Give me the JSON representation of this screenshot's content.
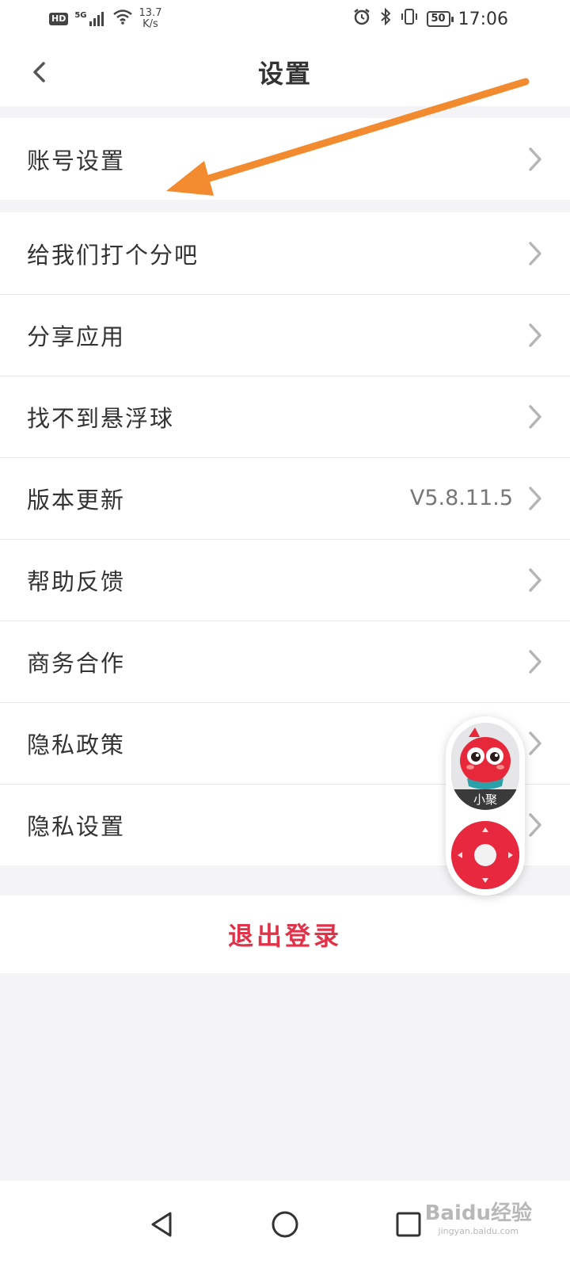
{
  "status_bar": {
    "hd": "HD",
    "net_type": "5G",
    "speed_value": "13.7",
    "speed_unit": "K/s",
    "battery": "50",
    "time": "17:06"
  },
  "header": {
    "title": "设置"
  },
  "account_section": {
    "items": [
      {
        "label": "账号设置"
      }
    ]
  },
  "settings_list": {
    "items": [
      {
        "label": "给我们打个分吧"
      },
      {
        "label": "分享应用"
      },
      {
        "label": "找不到悬浮球"
      },
      {
        "label": "版本更新",
        "value": "V5.8.11.5"
      },
      {
        "label": "帮助反馈"
      },
      {
        "label": "商务合作"
      },
      {
        "label": "隐私政策"
      },
      {
        "label": "隐私设置"
      }
    ]
  },
  "logout": {
    "label": "退出登录",
    "color": "#e0334a"
  },
  "float_ball": {
    "avatar_name": "小聚",
    "accent": "#e8283e"
  },
  "annotation": {
    "arrow_color": "#f28a30"
  },
  "watermark": {
    "main": "Baidu经验",
    "sub": "jingyan.baidu.com"
  },
  "icons": {
    "back": "back-chevron-icon",
    "row": "chevron-right-icon",
    "alarm": "alarm-icon",
    "bluetooth": "bluetooth-icon",
    "vibrate": "vibrate-icon",
    "wifi": "wifi-icon",
    "signal": "signal-icon"
  }
}
